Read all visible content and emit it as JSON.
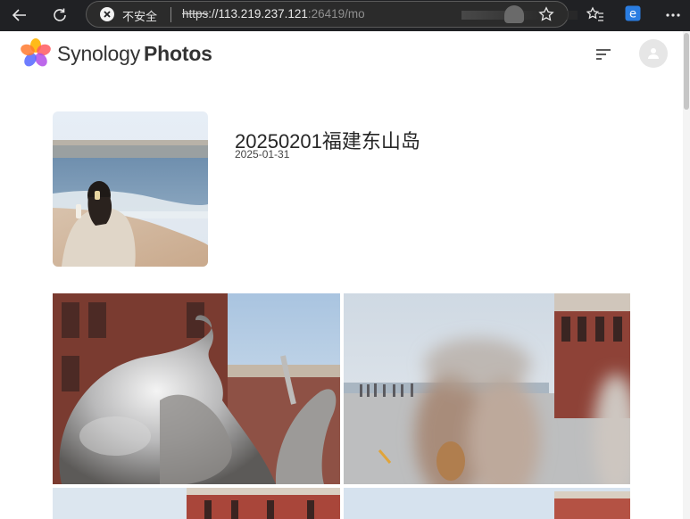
{
  "browser": {
    "security_label": "不安全",
    "url_scheme": "https",
    "url_host": "://113.219.237.121",
    "url_rest": ":26419/mo",
    "icons": [
      "back-icon",
      "refresh-icon",
      "warning-icon",
      "star-icon",
      "favorites-icon",
      "edge-icon",
      "more-icon"
    ]
  },
  "app": {
    "brand_regular": "Synology",
    "brand_bold": "Photos"
  },
  "album": {
    "title": "20250201福建东山岛",
    "date": "2025-01-31"
  },
  "photos": [
    {
      "subject": "silver sculpture"
    },
    {
      "subject": "seaside promenade"
    },
    {
      "subject": "building top"
    },
    {
      "subject": "building top"
    }
  ],
  "colors": {
    "chrome_bg": "#202124",
    "page_bg": "#ffffff",
    "title_text": "#262626"
  }
}
